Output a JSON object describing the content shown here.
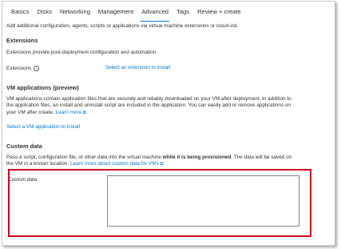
{
  "tabs": [
    {
      "label": "Basics"
    },
    {
      "label": "Disks"
    },
    {
      "label": "Networking"
    },
    {
      "label": "Management"
    },
    {
      "label": "Advanced"
    },
    {
      "label": "Tags"
    },
    {
      "label": "Review + create"
    }
  ],
  "intro": "Add additional configuration, agents, scripts or applications via virtual machine extensions or cloud-init.",
  "extensions": {
    "heading": "Extensions",
    "description": "Extensions provide post-deployment configuration and automation.",
    "label": "Extensions",
    "link": "Select an extension to install"
  },
  "vm_applications": {
    "heading": "VM applications (preview)",
    "line1": "VM applications contain application files that are securely and reliably downloaded on your VM after deployment. In addition to",
    "line2": "the application files, an install and uninstall script are included in the application. You can easily add or remove applications on",
    "line3": "your VM after create.",
    "learn_more": "Learn more",
    "select_link": "Select a VM application to install"
  },
  "custom_data": {
    "heading": "Custom data",
    "line1_pre": "Pass a script, configuration file, or other data into the virtual machine ",
    "line1_bold": "while it is being provisioned",
    "line1_post": ". The data will be saved on",
    "line2": "the VM in a known location.",
    "learn_more": "Learn more about custom data for VMs",
    "field_label": "Custom data",
    "field_value": ""
  },
  "colors": {
    "accent": "#0078d4",
    "highlight": "#d0021b"
  }
}
